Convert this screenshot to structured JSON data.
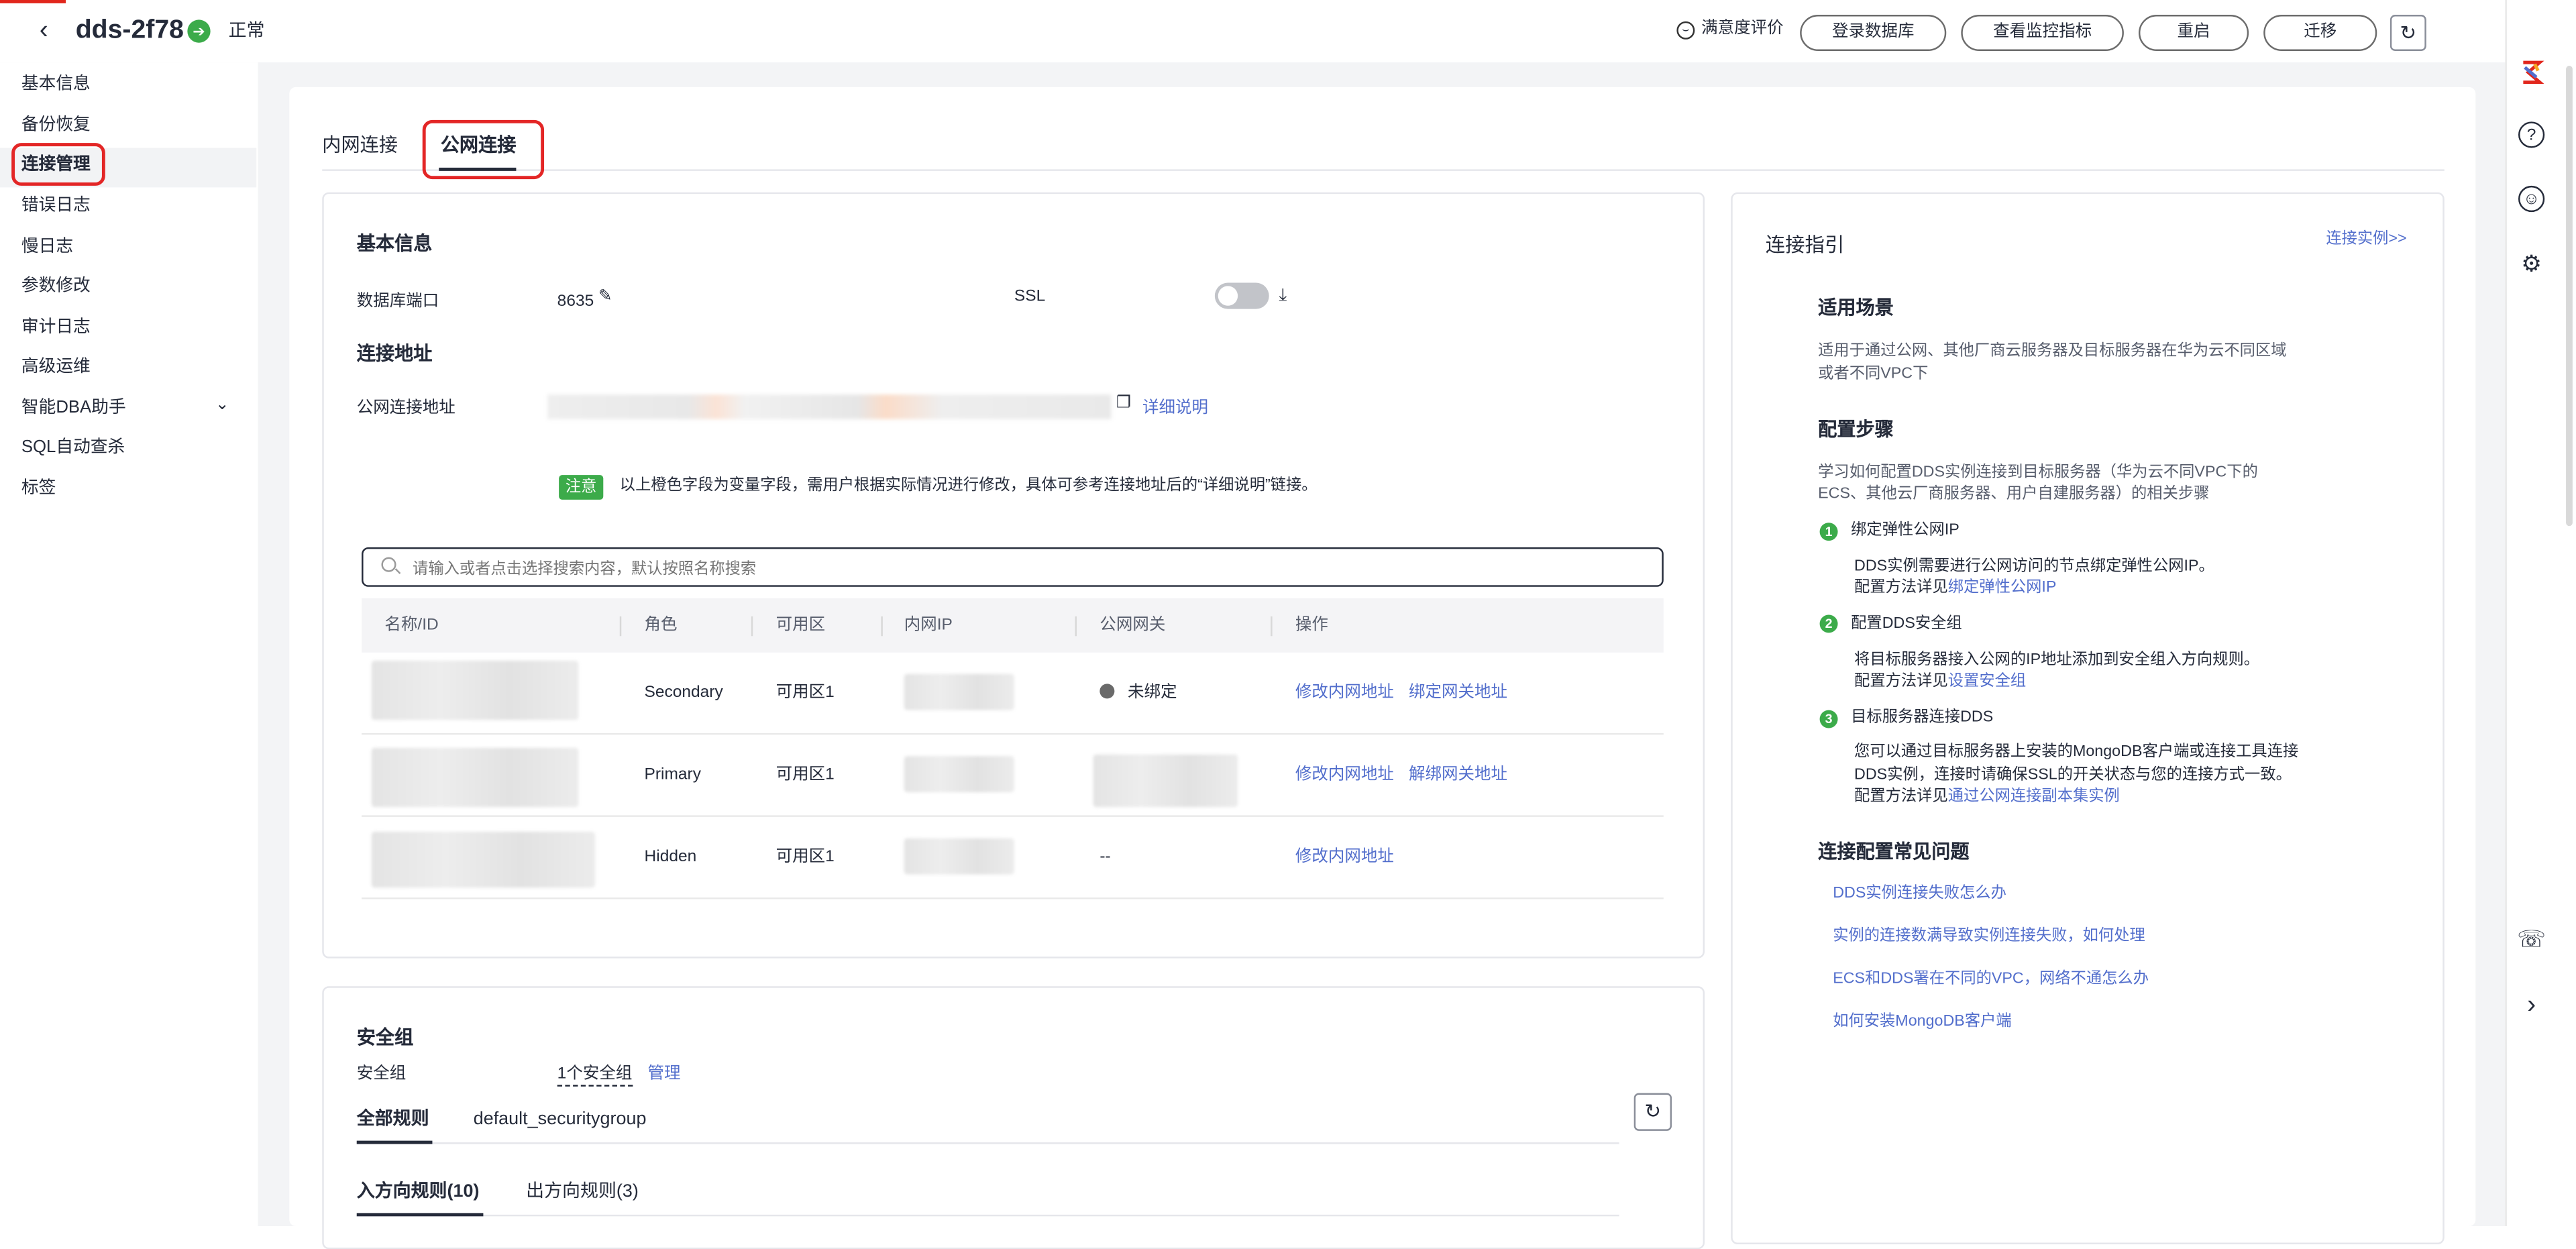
{
  "header": {
    "instance_name": "dds-2f78",
    "status": "正常",
    "satisfaction": "满意度评价",
    "buttons": [
      "登录数据库",
      "查看监控指标",
      "重启",
      "迁移"
    ]
  },
  "sidebar": {
    "items": [
      {
        "label": "基本信息"
      },
      {
        "label": "备份恢复"
      },
      {
        "label": "连接管理",
        "active": true
      },
      {
        "label": "错误日志"
      },
      {
        "label": "慢日志"
      },
      {
        "label": "参数修改"
      },
      {
        "label": "审计日志"
      },
      {
        "label": "高级运维"
      },
      {
        "label": "智能DBA助手"
      },
      {
        "label": "SQL自动查杀"
      },
      {
        "label": "标签"
      }
    ]
  },
  "tabs": {
    "private": "内网连接",
    "public": "公网连接"
  },
  "basic": {
    "title": "基本信息",
    "port_label": "数据库端口",
    "port_value": "8635",
    "ssl_label": "SSL",
    "ssl_enabled": false
  },
  "address": {
    "title": "连接地址",
    "public_label": "公网连接地址",
    "detail_link": "详细说明",
    "note_tag": "注意",
    "note_text": "以上橙色字段为变量字段，需用户根据实际情况进行修改，具体可参考连接地址后的“详细说明”链接。"
  },
  "search": {
    "placeholder": "请输入或者点击选择搜索内容，默认按照名称搜索"
  },
  "table": {
    "headers": [
      "名称/ID",
      "角色",
      "可用区",
      "内网IP",
      "公网网关",
      "操作"
    ],
    "rows": [
      {
        "role": "Secondary",
        "az": "可用区1",
        "gateway": "未绑定",
        "ops": [
          "修改内网地址",
          "绑定网关地址"
        ]
      },
      {
        "role": "Primary",
        "az": "可用区1",
        "gateway": "",
        "ops": [
          "修改内网地址",
          "解绑网关地址"
        ]
      },
      {
        "role": "Hidden",
        "az": "可用区1",
        "gateway": "--",
        "ops": [
          "修改内网地址"
        ]
      }
    ]
  },
  "security": {
    "title": "安全组",
    "label": "安全组",
    "count": "1个安全组",
    "manage": "管理",
    "tabs": [
      "全部规则",
      "default_securitygroup"
    ],
    "direction_tabs": [
      "入方向规则(10)",
      "出方向规则(3)"
    ]
  },
  "guide": {
    "title": "连接指引",
    "example_link": "连接实例>>",
    "scenario_title": "适用场景",
    "scenario_text_1": "适用于通过公网、其他厂商云服务器及目标服务器在华为云不同区域",
    "scenario_text_2": "或者不同VPC下",
    "steps_title": "配置步骤",
    "steps_intro_1": "学习如何配置DDS实例连接到目标服务器（华为云不同VPC下的",
    "steps_intro_2": "ECS、其他云厂商服务器、用户自建服务器）的相关步骤",
    "steps": [
      {
        "num": "1",
        "title": "绑定弹性公网IP",
        "lines": [
          "DDS实例需要进行公网访问的节点绑定弹性公网IP。"
        ],
        "ref_prefix": "配置方法详见",
        "ref_link": "绑定弹性公网IP"
      },
      {
        "num": "2",
        "title": "配置DDS安全组",
        "lines": [
          "将目标服务器接入公网的IP地址添加到安全组入方向规则。"
        ],
        "ref_prefix": "配置方法详见",
        "ref_link": "设置安全组"
      },
      {
        "num": "3",
        "title": "目标服务器连接DDS",
        "lines": [
          "您可以通过目标服务器上安装的MongoDB客户端或连接工具连接",
          "DDS实例，连接时请确保SSL的开关状态与您的连接方式一致。"
        ],
        "ref_prefix": "配置方法详见",
        "ref_link": "通过公网连接副本集实例"
      }
    ],
    "faq_title": "连接配置常见问题",
    "faq": [
      "DDS实例连接失败怎么办",
      "实例的连接数满导致实例连接失败，如何处理",
      "ECS和DDS署在不同的VPC，网络不通怎么办",
      "如何安装MongoDB客户端"
    ]
  },
  "colors": {
    "accent_link": "#526ecc",
    "status_green": "#3cab4a",
    "highlight_red": "#e32626"
  }
}
